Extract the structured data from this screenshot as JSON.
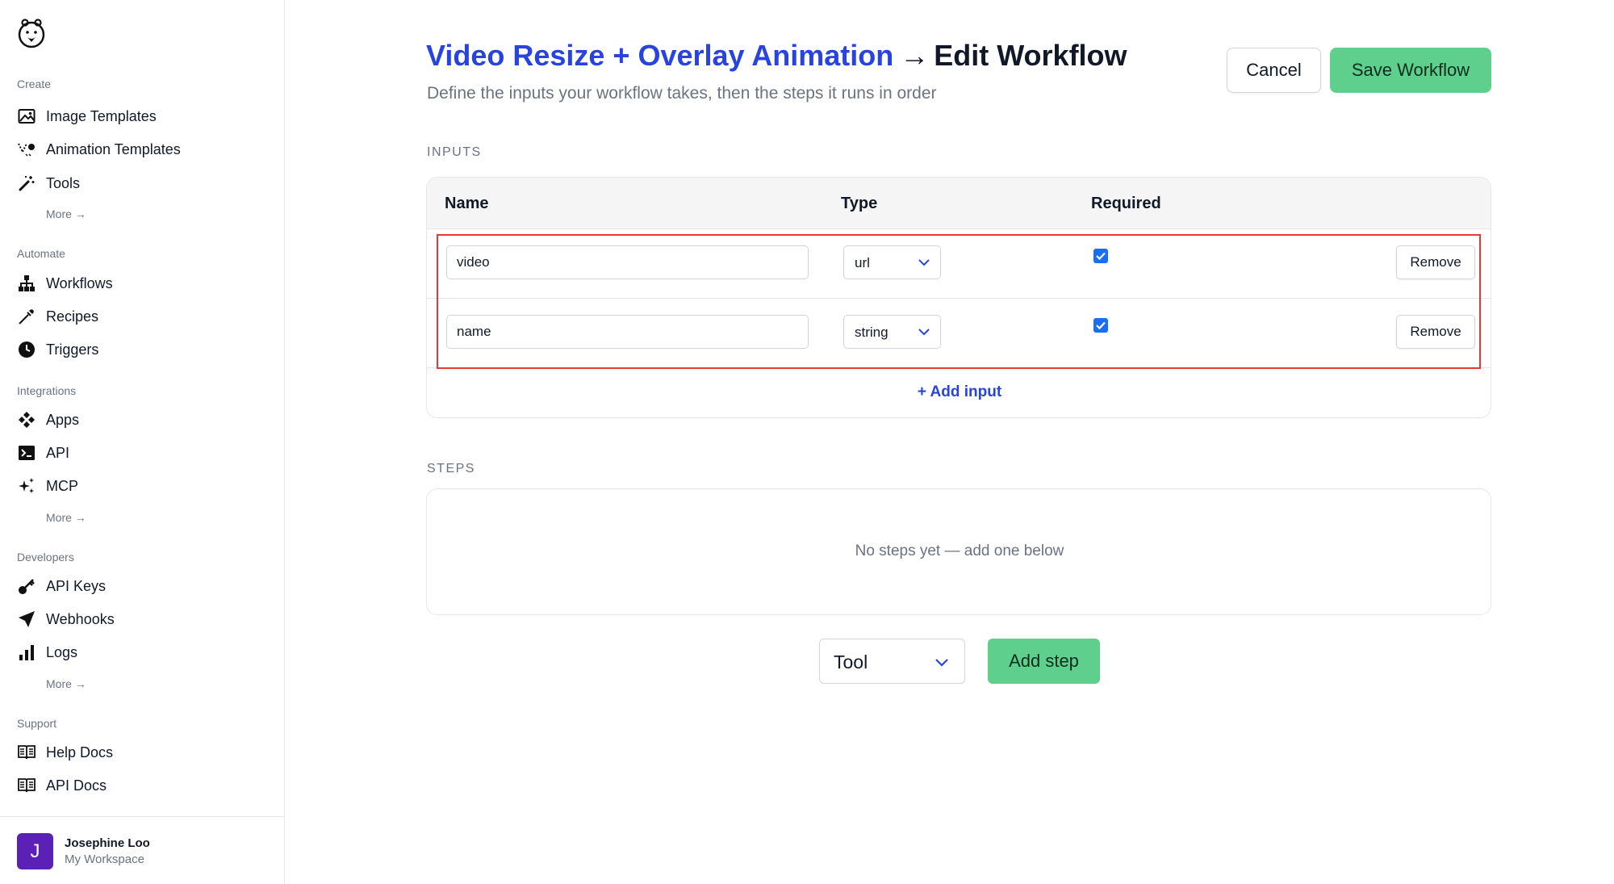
{
  "sidebar": {
    "sections": {
      "create": "Create",
      "automate": "Automate",
      "integrations": "Integrations",
      "developers": "Developers",
      "support": "Support"
    },
    "items": {
      "image_templates": "Image Templates",
      "animation_templates": "Animation Templates",
      "tools": "Tools",
      "workflows": "Workflows",
      "recipes": "Recipes",
      "triggers": "Triggers",
      "apps": "Apps",
      "api": "API",
      "mcp": "MCP",
      "api_keys": "API Keys",
      "webhooks": "Webhooks",
      "logs": "Logs",
      "help_docs": "Help Docs",
      "api_docs": "API Docs"
    },
    "more_label": "More →",
    "icons": {
      "logo": "bear-logo-icon",
      "image_templates": "image-icon",
      "animation_templates": "animation-icon",
      "tools": "magic-wand-icon",
      "workflows": "workflow-icon",
      "recipes": "pipette-icon",
      "triggers": "clock-icon",
      "apps": "apps-icon",
      "api": "terminal-icon",
      "mcp": "sparkles-icon",
      "api_keys": "key-icon",
      "webhooks": "send-icon",
      "logs": "bar-chart-icon",
      "help_docs": "book-icon",
      "api_docs": "book-icon"
    },
    "user": {
      "initial": "J",
      "name": "Josephine Loo",
      "workspace": "My Workspace"
    }
  },
  "header": {
    "workflow_name": "Video Resize + Overlay Animation",
    "arrow": "→",
    "page": "Edit Workflow",
    "subtitle": "Define the inputs your workflow takes, then the steps it runs in order",
    "cancel_label": "Cancel",
    "save_label": "Save Workflow"
  },
  "inputs": {
    "section_label": "INPUTS",
    "columns": [
      "Name",
      "Type",
      "Required"
    ],
    "rows": [
      {
        "name": "video",
        "type": "url",
        "required": true,
        "remove_label": "Remove"
      },
      {
        "name": "name",
        "type": "string",
        "required": true,
        "remove_label": "Remove"
      }
    ],
    "add_label": "+ Add input"
  },
  "steps": {
    "section_label": "STEPS",
    "empty_text": "No steps yet — add one below",
    "tool_select_value": "Tool",
    "add_step_label": "Add step"
  },
  "colors": {
    "accent_blue": "#2743e0",
    "save_green": "#5fcf8d",
    "checkbox_blue": "#1a6ef5",
    "highlight_red": "#e53935",
    "avatar_purple": "#5b21b6"
  }
}
